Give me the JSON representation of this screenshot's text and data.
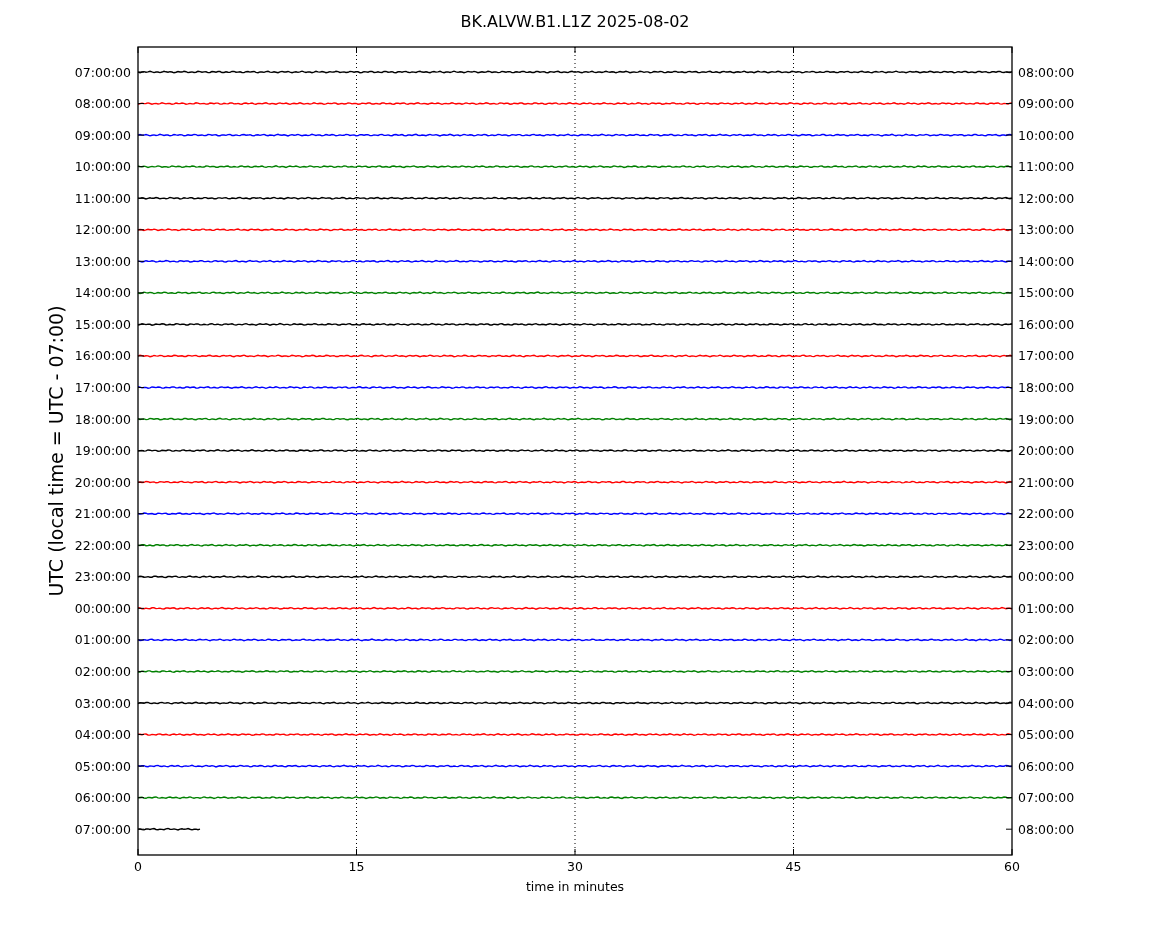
{
  "figure": {
    "title": "BK.ALVW.B1.L1Z 2025-08-02",
    "ylabel": "UTC (local time = UTC - 07:00)",
    "xlabel": "time in minutes",
    "xticks": [
      "0",
      "15",
      "30",
      "45",
      "60"
    ],
    "rows": [
      {
        "left": "07:00:00",
        "right": "08:00:00",
        "color": "#000000",
        "level": 1
      },
      {
        "left": "08:00:00",
        "right": "09:00:00",
        "color": "#ff0000",
        "level": 1
      },
      {
        "left": "09:00:00",
        "right": "10:00:00",
        "color": "#0000ff",
        "level": 1
      },
      {
        "left": "10:00:00",
        "right": "11:00:00",
        "color": "#008000",
        "level": 1
      },
      {
        "left": "11:00:00",
        "right": "12:00:00",
        "color": "#000000",
        "level": 1
      },
      {
        "left": "12:00:00",
        "right": "13:00:00",
        "color": "#ff0000",
        "level": 1
      },
      {
        "left": "13:00:00",
        "right": "14:00:00",
        "color": "#0000ff",
        "level": 1
      },
      {
        "left": "14:00:00",
        "right": "15:00:00",
        "color": "#008000",
        "level": 1
      },
      {
        "left": "15:00:00",
        "right": "16:00:00",
        "color": "#000000",
        "level": 1
      },
      {
        "left": "16:00:00",
        "right": "17:00:00",
        "color": "#ff0000",
        "level": 1
      },
      {
        "left": "17:00:00",
        "right": "18:00:00",
        "color": "#0000ff",
        "level": 1
      },
      {
        "left": "18:00:00",
        "right": "19:00:00",
        "color": "#008000",
        "level": 1
      },
      {
        "left": "19:00:00",
        "right": "20:00:00",
        "color": "#000000",
        "level": 1
      },
      {
        "left": "20:00:00",
        "right": "21:00:00",
        "color": "#ff0000",
        "level": 1
      },
      {
        "left": "21:00:00",
        "right": "22:00:00",
        "color": "#0000ff",
        "level": 1
      },
      {
        "left": "22:00:00",
        "right": "23:00:00",
        "color": "#008000",
        "level": 1
      },
      {
        "left": "23:00:00",
        "right": "00:00:00",
        "color": "#000000",
        "level": 1
      },
      {
        "left": "00:00:00",
        "right": "01:00:00",
        "color": "#ff0000",
        "level": 1
      },
      {
        "left": "01:00:00",
        "right": "02:00:00",
        "color": "#0000ff",
        "level": 1
      },
      {
        "left": "02:00:00",
        "right": "03:00:00",
        "color": "#008000",
        "level": 1
      },
      {
        "left": "03:00:00",
        "right": "04:00:00",
        "color": "#000000",
        "level": 1
      },
      {
        "left": "04:00:00",
        "right": "05:00:00",
        "color": "#ff0000",
        "level": 1
      },
      {
        "left": "05:00:00",
        "right": "06:00:00",
        "color": "#0000ff",
        "level": 1
      },
      {
        "left": "06:00:00",
        "right": "07:00:00",
        "color": "#008000",
        "level": 1
      },
      {
        "left": "07:00:00",
        "right": "08:00:00",
        "color": "#000000",
        "level": 0.073
      }
    ]
  }
}
